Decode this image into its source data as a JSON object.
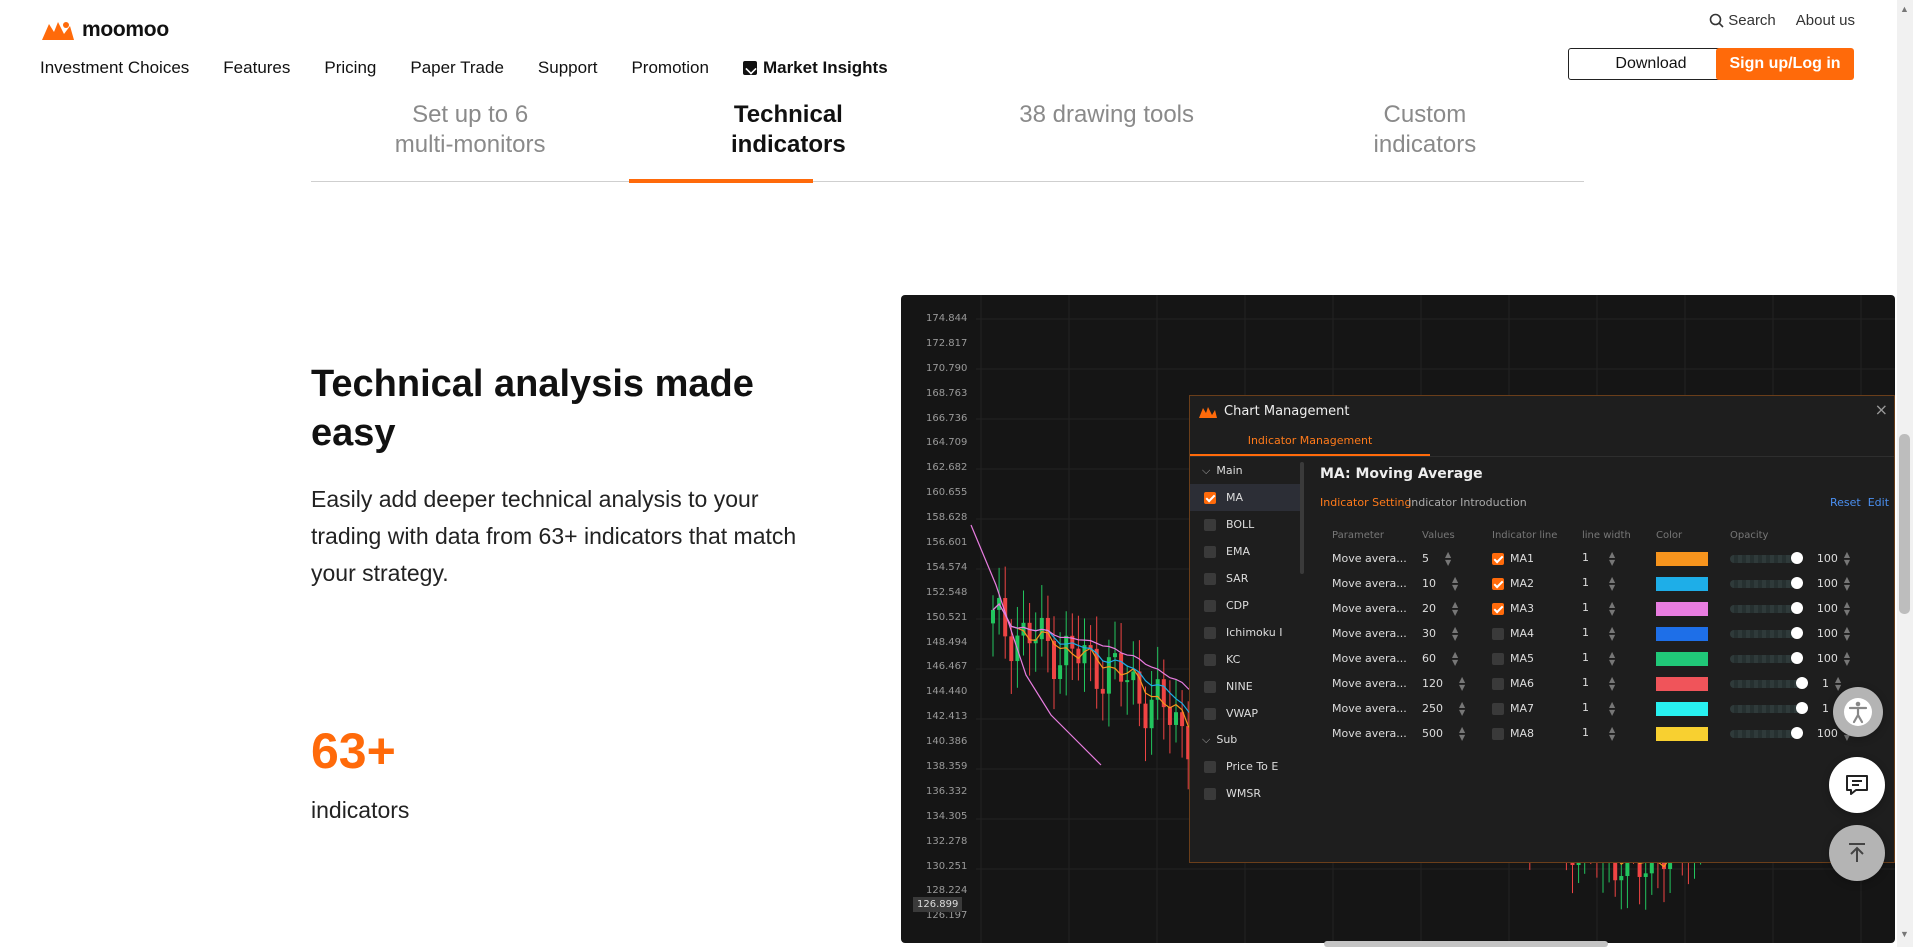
{
  "header": {
    "brand": "moomoo",
    "nav": [
      "Investment Choices",
      "Features",
      "Pricing",
      "Paper Trade",
      "Support",
      "Promotion"
    ],
    "market_insights": "Market Insights",
    "search": "Search",
    "about": "About us",
    "download": "Download",
    "signup": "Sign up/Log in"
  },
  "tabs": [
    "Set up to 6 multi-monitors",
    "Technical indicators",
    "38 drawing tools",
    "Custom indicators"
  ],
  "active_tab": "Technical indicators",
  "content": {
    "heading": "Technical analysis made easy",
    "description": "Easily add deeper technical analysis to your trading with data from 63+ indicators that match your strategy.",
    "stat_value": "63+",
    "stat_label": "indicators"
  },
  "chart": {
    "y_ticks": [
      "174.844",
      "172.817",
      "170.790",
      "168.763",
      "166.736",
      "164.709",
      "162.682",
      "160.655",
      "158.628",
      "156.601",
      "154.574",
      "152.548",
      "150.521",
      "148.494",
      "146.467",
      "144.440",
      "142.413",
      "140.386",
      "138.359",
      "136.332",
      "134.305",
      "132.278",
      "130.251",
      "128.224",
      "126.197"
    ],
    "current_price": "126.899"
  },
  "dialog": {
    "title": "Chart Management",
    "tab": "Indicator Management",
    "group_main": "Main",
    "main_items": [
      "MA",
      "BOLL",
      "EMA",
      "SAR",
      "CDP",
      "Ichimoku I",
      "KC",
      "NINE",
      "VWAP"
    ],
    "group_sub": "Sub",
    "sub_items": [
      "Price To E",
      "WMSR"
    ],
    "indicator_title": "MA: Moving Average",
    "setting_tab": "Indicator Setting",
    "intro_tab": "Indicator Introduction",
    "reset": "Reset",
    "edit": "Edit",
    "columns": [
      "Parameter",
      "Values",
      "Indicator line",
      "line width",
      "Color",
      "Opacity"
    ],
    "rows": [
      {
        "param": "Move avera...",
        "value": "5",
        "line": "MA1",
        "checked": true,
        "width": "1",
        "color": "#f7941d",
        "opacity": "100"
      },
      {
        "param": "Move avera...",
        "value": "10",
        "line": "MA2",
        "checked": true,
        "width": "1",
        "color": "#1eaee8",
        "opacity": "100"
      },
      {
        "param": "Move avera...",
        "value": "20",
        "line": "MA3",
        "checked": true,
        "width": "1",
        "color": "#e87de0",
        "opacity": "100"
      },
      {
        "param": "Move avera...",
        "value": "30",
        "line": "MA4",
        "checked": false,
        "width": "1",
        "color": "#1e6fe8",
        "opacity": "100"
      },
      {
        "param": "Move avera...",
        "value": "60",
        "line": "MA5",
        "checked": false,
        "width": "1",
        "color": "#20c878",
        "opacity": "100"
      },
      {
        "param": "Move avera...",
        "value": "120",
        "line": "MA6",
        "checked": false,
        "width": "1",
        "color": "#f0545a",
        "opacity": "1"
      },
      {
        "param": "Move avera...",
        "value": "250",
        "line": "MA7",
        "checked": false,
        "width": "1",
        "color": "#28f0f0",
        "opacity": "1"
      },
      {
        "param": "Move avera...",
        "value": "500",
        "line": "MA8",
        "checked": false,
        "width": "1",
        "color": "#f8d030",
        "opacity": "100"
      }
    ]
  },
  "colors": {
    "brand_orange": "#ff6a0a",
    "up": "#22c55e",
    "down": "#ef4444"
  }
}
